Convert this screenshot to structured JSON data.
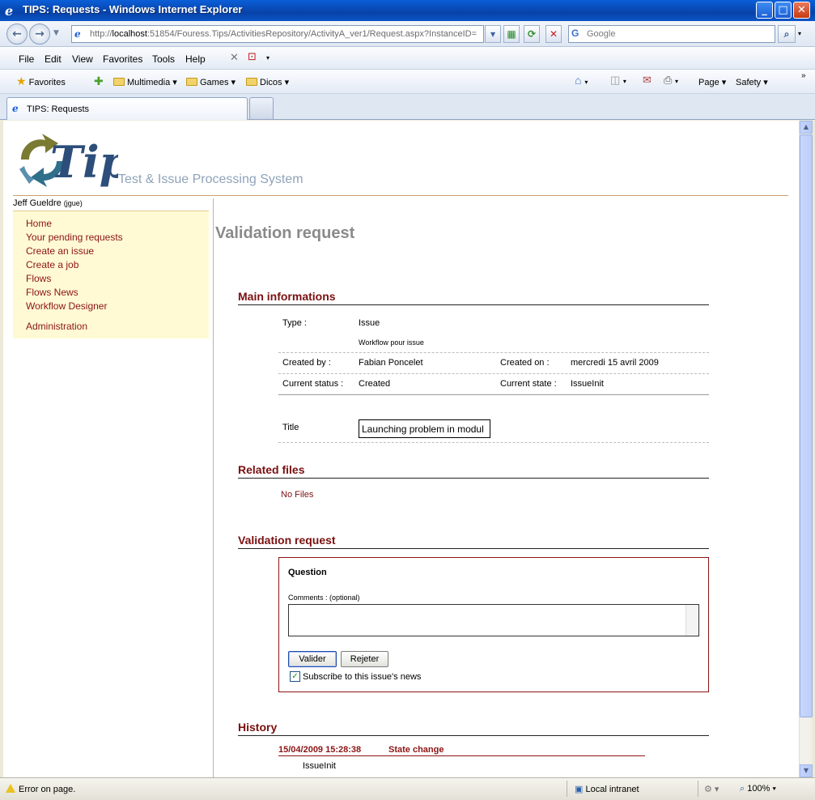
{
  "window": {
    "title": "TIPS: Requests - Windows Internet Explorer"
  },
  "address": {
    "url_prefix": "http://",
    "url_host": "localhost",
    "url_rest": ":51854/Fouress.Tips/ActivitiesRepository/ActivityA_ver1/Request.aspx?InstanceID=",
    "search_placeholder": "Google"
  },
  "menu": [
    "File",
    "Edit",
    "View",
    "Favorites",
    "Tools",
    "Help"
  ],
  "favorites": {
    "label": "Favorites",
    "folders": [
      "Multimedia",
      "Games",
      "Dicos"
    ],
    "right": [
      "Page",
      "Safety"
    ]
  },
  "tab": {
    "label": "TIPS: Requests"
  },
  "logo": {
    "word": "Tips",
    "subtitle": "Test & Issue Processing System"
  },
  "user": {
    "name": "Jeff Gueldre",
    "login": "(jgue)"
  },
  "nav": [
    "Home",
    "Your pending requests",
    "Create an issue",
    "Create a job",
    "Flows",
    "Flows News",
    "Workflow Designer",
    "Administration"
  ],
  "page": {
    "title": "Validation request"
  },
  "main_info": {
    "header": "Main informations",
    "type_label": "Type :",
    "type_value": "Issue",
    "type_desc": "Workflow pour issue",
    "created_by_label": "Created by :",
    "created_by_value": "Fabian Poncelet",
    "created_on_label": "Created on :",
    "created_on_value": "mercredi 15 avril 2009",
    "status_label": "Current status :",
    "status_value": "Created",
    "state_label": "Current state :",
    "state_value": "IssueInit",
    "title_label": "Title",
    "title_value": "Launching problem in modul"
  },
  "related": {
    "header": "Related files",
    "empty": "No Files"
  },
  "validation": {
    "header": "Validation request",
    "question": "Question",
    "comments_label": "Comments : (optional)",
    "accept": "Valider",
    "reject": "Rejeter",
    "subscribe": "Subscribe to this issue's news",
    "subscribed": true
  },
  "history": {
    "header": "History",
    "date": "15/04/2009 15:28:38",
    "kind": "State change",
    "value": "IssueInit"
  },
  "status": {
    "left": "Error on page.",
    "zone": "Local intranet",
    "zoom": "100%"
  }
}
